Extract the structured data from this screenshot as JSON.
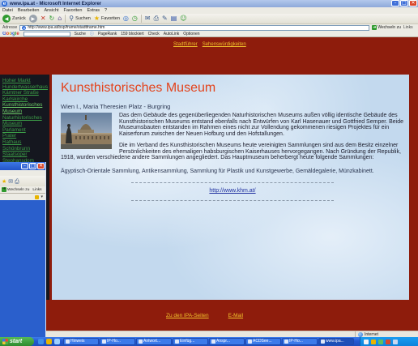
{
  "window": {
    "title": "www.ipa.at - Microsoft Internet Explorer"
  },
  "menu": {
    "items": [
      "Datei",
      "Bearbeiten",
      "Ansicht",
      "Favoriten",
      "Extras",
      "?"
    ]
  },
  "toolbar": {
    "back": "Zurück",
    "search": "Suchen",
    "favorites": "Favoriten"
  },
  "address": {
    "label": "Adresse",
    "url": "http://www.ipa.at/bsp/frame/stadtframe.htm",
    "go": "Wechseln zu",
    "links": "Links"
  },
  "google": {
    "logo": "Google",
    "search_button": "Suche",
    "pagerank": "PageRank",
    "popups": "159 blockiert",
    "check": "Check",
    "autolink": "AutoLink",
    "options": "Optionen"
  },
  "page": {
    "nav": [
      "Stadtführer",
      "Sehenswürdigkeiten"
    ],
    "sidebar": [
      "Hoher Markt",
      "Hundertwasserhaus",
      "Kärntner Straße",
      "Karlskirche",
      "Kunsthistorisches Museum",
      "Naturhistorisches Museum",
      "Parlament",
      "Prater",
      "Rathaus",
      "Schönbrunn",
      "Staatsoper",
      "Stephansdom"
    ],
    "title": "Kunsthistorisches Museum",
    "subtitle": "Wien I., Maria Theresien Platz - Burgring",
    "paragraphs": [
      "Das dem Gebäude des gegenüberliegenden Naturhistorischen Museums außen völlig identische Gebäude des Kunsthistorischen Museums entstand ebenfalls nach Entwürfen von Karl Hasenauer und Gottfried Semper. Beide Museumsbauten entstanden im Rahmen eines nicht zur Vollendung gekommenen riesigen Projektes für ein Kaiserforum zwischen der Neuen Hofburg und den Hofstallungen.",
      "Die im Verband des Kunsthistorischen Museums heute vereinigten Sammlungen sind aus dem Besitz einzelner Persönlichkeiten des ehemaligen habsburgischen Kaiserhauses hervorgegangen. Nach Gründung der Republik, 1918, wurden verschiedene andere Sammlungen angegliedert. Das Hauptmuseum beherbergt heute folgende Sammlungen:"
    ],
    "collections": "Ägyptisch-Orientale Sammlung, Antikensammlung, Sammlung für Plastik und Kunstgewerbe, Gemäldegalerie, Münzkabinett.",
    "link": "http://www.khm.at/",
    "footer": [
      "Zu den IPA-Seiten",
      "E-Mail"
    ]
  },
  "status": {
    "zone": "Internet"
  },
  "second_window": {
    "go": "Wechseln zu",
    "links": "Links"
  },
  "taskbar": {
    "start": "start",
    "items": [
      "Hinweis",
      "IP-Ho...",
      "Antwort...",
      "Einfüg...",
      "Anspr...",
      "ACDSee...",
      "IP-Ho...",
      "www.ipa..."
    ]
  },
  "colors": {
    "frame": "#8e1c0c",
    "title_accent": "#e3431c",
    "frame_link": "#f1c22c",
    "sidebar_bg": "#15171f",
    "sidebar_link": "#3c9e48",
    "content_bg": "#c3d9ee"
  }
}
